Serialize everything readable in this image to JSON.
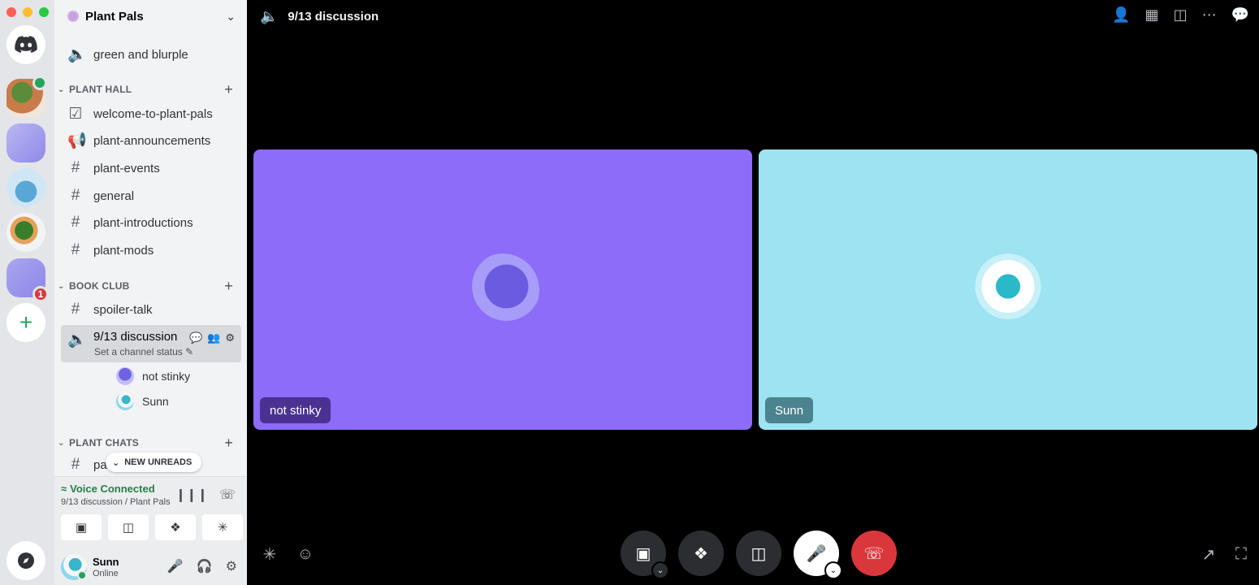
{
  "server_rail": {
    "mention_count": "1"
  },
  "guild": {
    "name": "Plant Pals"
  },
  "channels": {
    "top": [
      {
        "name": "green and blurple",
        "icon": "speaker-icon"
      }
    ],
    "plant_hall": {
      "title": "PLANT HALL",
      "items": [
        {
          "name": "welcome-to-plant-pals",
          "icon": "rules-icon"
        },
        {
          "name": "plant-announcements",
          "icon": "megaphone-icon"
        },
        {
          "name": "plant-events",
          "icon": "hash-icon"
        },
        {
          "name": "general",
          "icon": "hash-icon"
        },
        {
          "name": "plant-introductions",
          "icon": "hash-icon"
        },
        {
          "name": "plant-mods",
          "icon": "locked-hash-icon"
        }
      ]
    },
    "book_club": {
      "title": "BOOK CLUB",
      "items": [
        {
          "name": "spoiler-talk",
          "icon": "hash-icon"
        }
      ],
      "active_voice": {
        "name": "9/13 discussion",
        "status": "Set a channel status",
        "participants": [
          "not stinky",
          "Sunn"
        ]
      }
    },
    "plant_chats": {
      "title": "PLANT CHATS",
      "items": [
        {
          "name": "party-planning",
          "icon": "hash-icon"
        }
      ]
    },
    "new_unreads": "NEW UNREADS"
  },
  "voice_panel": {
    "title": "Voice Connected",
    "subtitle": "9/13 discussion / Plant Pals"
  },
  "user_panel": {
    "name": "Sunn",
    "status": "Online"
  },
  "call": {
    "title": "9/13 discussion",
    "tiles": [
      {
        "name": "not stinky",
        "color": "#8c6cf8"
      },
      {
        "name": "Sunn",
        "color": "#9de3f2"
      }
    ]
  },
  "colors": {
    "accent": "#5865f2",
    "connected_green": "#248046",
    "leave_red": "#da373c"
  }
}
